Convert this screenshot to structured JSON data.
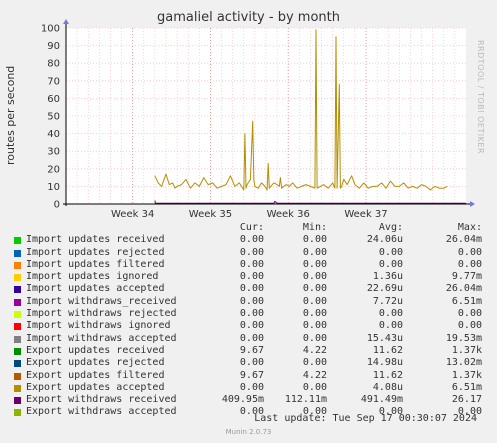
{
  "title": "gamaliel activity - by month",
  "side_credit": "RRDTOOL / TOBI OETIKER",
  "munin_version": "Munin 2.0.73",
  "last_update": "Last update: Tue Sep 17 00:30:07 2024",
  "legend": {
    "headers": {
      "cur": "Cur:",
      "min": "Min:",
      "avg": "Avg:",
      "max": "Max:"
    },
    "rows": [
      {
        "name": "Import updates received",
        "color": "#00cc00",
        "cur": "0.00",
        "min": "0.00",
        "avg": "24.06u",
        "max": "26.04m"
      },
      {
        "name": "Import updates rejected",
        "color": "#0066b3",
        "cur": "0.00",
        "min": "0.00",
        "avg": "0.00",
        "max": "0.00"
      },
      {
        "name": "Import updates filtered",
        "color": "#ff8000",
        "cur": "0.00",
        "min": "0.00",
        "avg": "0.00",
        "max": "0.00"
      },
      {
        "name": "Import updates ignored",
        "color": "#ffcc00",
        "cur": "0.00",
        "min": "0.00",
        "avg": "1.36u",
        "max": "9.77m"
      },
      {
        "name": "Import updates accepted",
        "color": "#330099",
        "cur": "0.00",
        "min": "0.00",
        "avg": "22.69u",
        "max": "26.04m"
      },
      {
        "name": "Import withdraws_received",
        "color": "#990099",
        "cur": "0.00",
        "min": "0.00",
        "avg": "7.72u",
        "max": "6.51m"
      },
      {
        "name": "Import withdraws rejected",
        "color": "#ccff00",
        "cur": "0.00",
        "min": "0.00",
        "avg": "0.00",
        "max": "0.00"
      },
      {
        "name": "Import withdraws ignored",
        "color": "#ff0000",
        "cur": "0.00",
        "min": "0.00",
        "avg": "0.00",
        "max": "0.00"
      },
      {
        "name": "Import withdraws accepted",
        "color": "#808080",
        "cur": "0.00",
        "min": "0.00",
        "avg": "15.43u",
        "max": "19.53m"
      },
      {
        "name": "Export updates received",
        "color": "#008f00",
        "cur": "9.67",
        "min": "4.22",
        "avg": "11.62",
        "max": "1.37k"
      },
      {
        "name": "Export updates rejected",
        "color": "#00487d",
        "cur": "0.00",
        "min": "0.00",
        "avg": "14.98u",
        "max": "13.02m"
      },
      {
        "name": "Export updates filtered",
        "color": "#b35a00",
        "cur": "9.67",
        "min": "4.22",
        "avg": "11.62",
        "max": "1.37k"
      },
      {
        "name": "Export updates accepted",
        "color": "#b38f00",
        "cur": "0.00",
        "min": "0.00",
        "avg": "4.08u",
        "max": "6.51m"
      },
      {
        "name": "Export withdraws received",
        "color": "#6b006b",
        "cur": "409.95m",
        "min": "112.11m",
        "avg": "491.49m",
        "max": "26.17"
      },
      {
        "name": "Export withdraws accepted",
        "color": "#8fb300",
        "cur": "0.00",
        "min": "0.00",
        "avg": "0.00",
        "max": "0.00"
      }
    ]
  },
  "chart_data": {
    "type": "line",
    "title": "gamaliel activity - by month",
    "ylabel": "routes per second",
    "xlabel": "",
    "ylim": [
      0,
      100
    ],
    "yticks": [
      0,
      10,
      20,
      30,
      40,
      50,
      60,
      70,
      80,
      90,
      100
    ],
    "xlim": [
      0,
      36
    ],
    "xtick_labels": [
      {
        "x": 6,
        "label": "Week 34"
      },
      {
        "x": 13,
        "label": "Week 35"
      },
      {
        "x": 20,
        "label": "Week 36"
      },
      {
        "x": 27,
        "label": "Week 37"
      }
    ],
    "grid": true,
    "series": [
      {
        "name": "Export updates filtered",
        "color": "#b38f00",
        "x": [
          8.0,
          8.3,
          8.6,
          9.0,
          9.3,
          9.6,
          9.8,
          10.0,
          10.4,
          10.8,
          11.2,
          11.6,
          12.0,
          12.4,
          12.8,
          13.2,
          13.6,
          14.0,
          14.4,
          14.8,
          15.2,
          15.6,
          16.0,
          16.1,
          16.2,
          16.3,
          16.6,
          16.8,
          16.9,
          17.0,
          17.3,
          17.6,
          17.9,
          18.1,
          18.2,
          18.3,
          18.7,
          19.0,
          19.2,
          19.3,
          19.4,
          19.8,
          20.1,
          20.4,
          20.8,
          21.2,
          21.6,
          22.0,
          22.4,
          22.5,
          22.6,
          22.9,
          23.2,
          23.6,
          24.0,
          24.2,
          24.3,
          24.4,
          24.6,
          24.7,
          24.8,
          25.0,
          25.3,
          25.7,
          26.0,
          26.4,
          26.8,
          27.2,
          27.6,
          28.0,
          28.4,
          28.8,
          29.2,
          29.6,
          30.0,
          30.4,
          30.8,
          31.2,
          31.6,
          32.0,
          32.4,
          32.8,
          33.2,
          33.6,
          34.0,
          34.3
        ],
        "y": [
          16,
          12,
          10,
          17,
          11,
          12,
          9,
          10,
          11,
          14,
          9,
          12,
          10,
          15,
          11,
          12,
          9,
          10,
          11,
          16,
          10,
          12,
          8,
          40,
          9,
          11,
          14,
          47,
          14,
          10,
          9,
          12,
          10,
          8,
          23,
          9,
          12,
          11,
          10,
          15,
          9,
          11,
          10,
          12,
          9,
          10,
          11,
          10,
          9,
          99,
          9,
          10,
          11,
          9,
          12,
          9,
          95,
          9,
          68,
          9,
          10,
          14,
          11,
          16,
          11,
          9,
          12,
          9,
          10,
          10,
          12,
          9,
          13,
          10,
          10,
          12,
          9,
          10,
          9,
          11,
          10,
          8,
          10,
          9,
          9,
          10
        ]
      },
      {
        "name": "Export withdraws received",
        "color": "#6b006b",
        "x": [
          8.0,
          8.05,
          8.3,
          16.0,
          18.7,
          18.8,
          19.0,
          20.0,
          28.0,
          36.0
        ],
        "y": [
          2,
          0.4,
          0.4,
          0.4,
          0.4,
          1.5,
          0.4,
          0.4,
          0.4,
          0.4
        ]
      }
    ]
  }
}
